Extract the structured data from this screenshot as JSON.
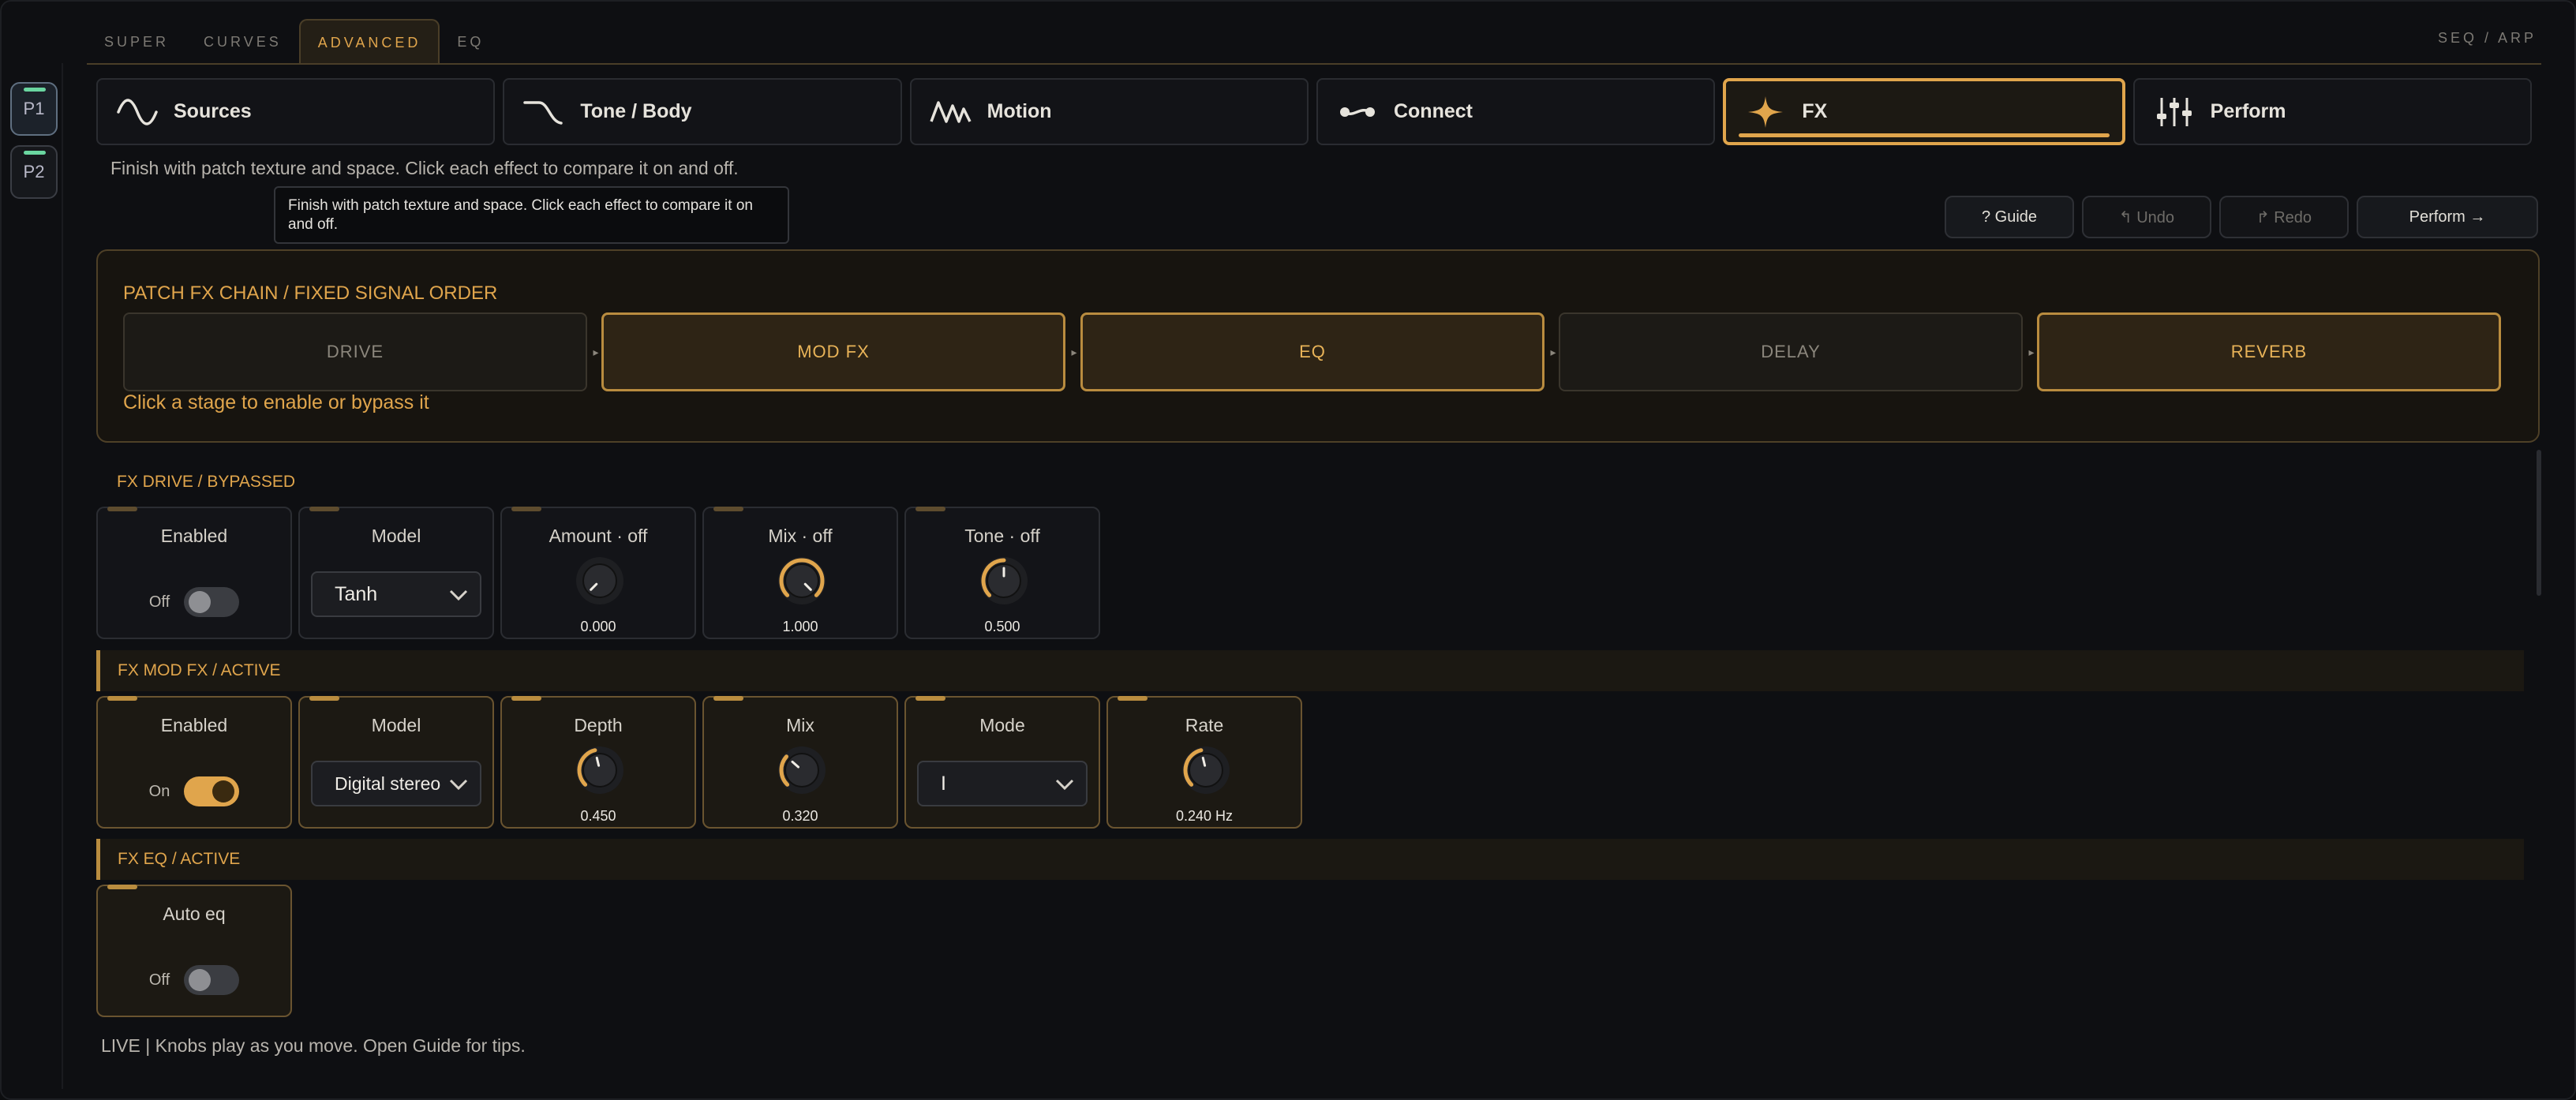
{
  "top_tabs": [
    {
      "label": "SUPER"
    },
    {
      "label": "CURVES"
    },
    {
      "label": "ADVANCED"
    },
    {
      "label": "EQ"
    }
  ],
  "top_right_label": "SEQ / ARP",
  "patches": [
    {
      "label": "P1"
    },
    {
      "label": "P2"
    }
  ],
  "section_tabs": [
    {
      "label": "Sources",
      "icon": "sine-wave-icon"
    },
    {
      "label": "Tone / Body",
      "icon": "filter-curve-icon"
    },
    {
      "label": "Motion",
      "icon": "lfo-wave-icon"
    },
    {
      "label": "Connect",
      "icon": "connect-icon"
    },
    {
      "label": "FX",
      "icon": "sparkle-icon"
    },
    {
      "label": "Perform",
      "icon": "sliders-icon"
    }
  ],
  "hint": "Finish with patch texture and space. Click each effect to compare it on and off.",
  "tooltip": "Finish with patch texture and space. Click each effect to compare it on and off.",
  "toolbar": {
    "guide": "? Guide",
    "undo": "↰ Undo",
    "redo": "↱ Redo",
    "perform": "Perform →"
  },
  "chain": {
    "title": "PATCH FX CHAIN  /  FIXED SIGNAL ORDER",
    "stages": [
      {
        "label": "DRIVE",
        "enabled": false
      },
      {
        "label": "MOD FX",
        "enabled": true
      },
      {
        "label": "EQ",
        "enabled": true
      },
      {
        "label": "DELAY",
        "enabled": false
      },
      {
        "label": "REVERB",
        "enabled": true
      }
    ],
    "hint": "Click a stage to enable or bypass it"
  },
  "groups": {
    "drive": {
      "title": "FX DRIVE  /  BYPASSED",
      "enabled_label": "Enabled",
      "enabled_state": "Off",
      "model_label": "Model",
      "model_value": "Tanh",
      "knobs": [
        {
          "label": "Amount · off",
          "value": "0.000",
          "level": 0.0
        },
        {
          "label": "Mix · off",
          "value": "1.000",
          "level": 1.0
        },
        {
          "label": "Tone · off",
          "value": "0.500",
          "level": 0.5
        }
      ]
    },
    "modfx": {
      "title": "FX MOD FX  /  ACTIVE",
      "enabled_label": "Enabled",
      "enabled_state": "On",
      "model_label": "Model",
      "model_value": "Digital stereo",
      "depth": {
        "label": "Depth",
        "value": "0.450",
        "level": 0.45
      },
      "mix": {
        "label": "Mix",
        "value": "0.320",
        "level": 0.32
      },
      "mode_label": "Mode",
      "mode_value": "I",
      "rate": {
        "label": "Rate",
        "value": "0.240 Hz",
        "level": 0.45
      }
    },
    "eq": {
      "title": "FX EQ  /  ACTIVE",
      "auto_label": "Auto eq",
      "auto_state": "Off"
    }
  },
  "footer": "LIVE | Knobs play as you move. Open Guide for tips.",
  "colors": {
    "accent": "#e0a54c",
    "background": "#0e0f12",
    "led": "#6ad6a0"
  }
}
